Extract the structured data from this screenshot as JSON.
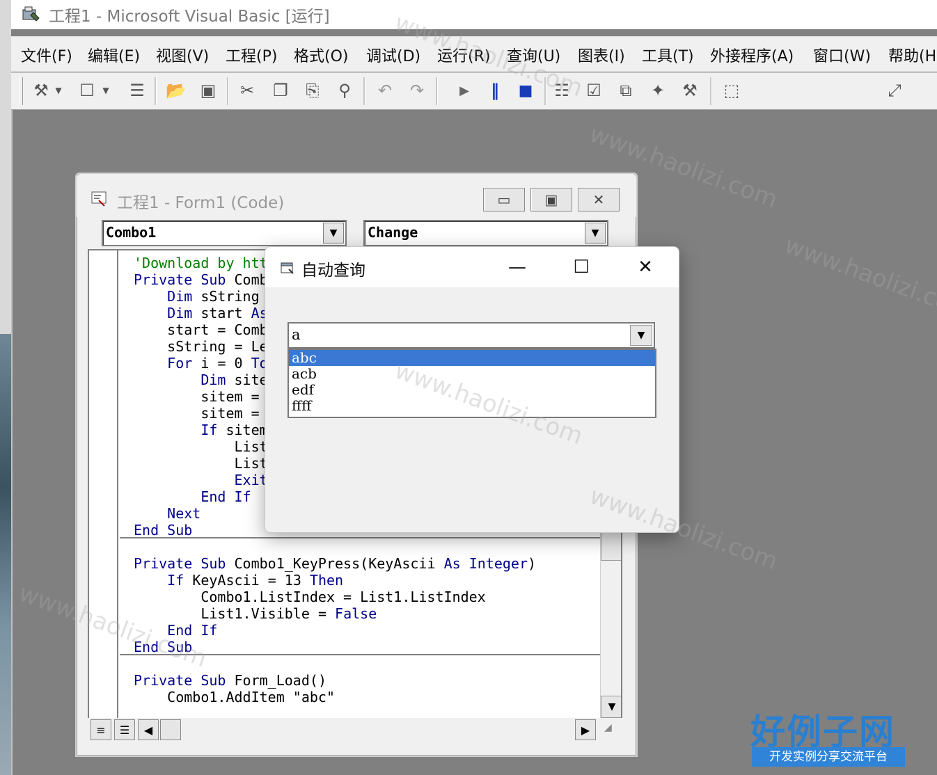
{
  "app": {
    "title": "工程1 - Microsoft Visual Basic [运行]"
  },
  "menu": [
    "文件(F)",
    "编辑(E)",
    "视图(V)",
    "工程(P)",
    "格式(O)",
    "调试(D)",
    "运行(R)",
    "查询(U)",
    "图表(I)",
    "工具(T)",
    "外接程序(A)",
    "窗口(W)",
    "帮助(H"
  ],
  "toolbar": {
    "icons": [
      "add-project-icon",
      "dropdown-arrow-icon",
      "add-form-icon",
      "dropdown-arrow-icon",
      "menu-editor-icon",
      "open-project-icon",
      "save-project-icon",
      "cut-icon",
      "copy-icon",
      "paste-icon",
      "find-icon",
      "undo-icon",
      "redo-icon",
      "start-icon",
      "break-icon",
      "end-icon",
      "project-explorer-icon",
      "properties-window-icon",
      "form-layout-icon",
      "object-browser-icon",
      "toolbox-icon",
      "data-view-icon",
      "position-icon"
    ]
  },
  "code_window": {
    "title": "工程1 - Form1 (Code)",
    "object_combo": "Combo1",
    "proc_combo": "Change",
    "lines": [
      {
        "text": "'Download by htt",
        "color": "comment"
      },
      {
        "text": "Private Sub Comb",
        "color": "mixed"
      },
      {
        "text": "    Dim sString ",
        "color": "mixed"
      },
      {
        "text": "    Dim start As",
        "color": "mixed"
      },
      {
        "text": "    start = Comb",
        "color": "plain"
      },
      {
        "text": "    sString = Le",
        "color": "plain"
      },
      {
        "text": "    For i = 0 To",
        "color": "mixed"
      },
      {
        "text": "        Dim site",
        "color": "mixed"
      },
      {
        "text": "        sitem = ",
        "color": "plain"
      },
      {
        "text": "        sitem = ",
        "color": "plain"
      },
      {
        "text": "        If sitem",
        "color": "mixed"
      },
      {
        "text": "            List",
        "color": "plain"
      },
      {
        "text": "            List",
        "color": "plain"
      },
      {
        "text": "            Exit",
        "color": "keyword"
      },
      {
        "text": "        End If",
        "color": "keyword"
      },
      {
        "text": "    Next",
        "color": "keyword"
      },
      {
        "text": "End Sub",
        "color": "keyword"
      },
      {
        "text": "",
        "color": "plain"
      },
      {
        "text": "Private Sub Combo1_KeyPress(KeyAscii As Integer)",
        "color": "mixed"
      },
      {
        "text": "    If KeyAscii = 13 Then",
        "color": "mixed"
      },
      {
        "text": "        Combo1.ListIndex = List1.ListIndex",
        "color": "plain"
      },
      {
        "text": "        List1.Visible = False",
        "color": "mixed"
      },
      {
        "text": "    End If",
        "color": "keyword"
      },
      {
        "text": "End Sub",
        "color": "keyword"
      },
      {
        "text": "",
        "color": "plain"
      },
      {
        "text": "Private Sub Form_Load()",
        "color": "mixed"
      },
      {
        "text": "    Combo1.AddItem \"abc\"",
        "color": "plain"
      }
    ]
  },
  "dialog": {
    "title": "自动查询",
    "combo_value": "a",
    "list_items": [
      "abc",
      "acb",
      "edf",
      "ffff"
    ],
    "selected_index": 0
  },
  "watermark": {
    "text": "www.haolizi.com",
    "logo": "好例子网",
    "logo_sub": "开发实例分享交流平台"
  },
  "colors": {
    "keyword": "#00008b",
    "comment": "#008000",
    "selection": "#3a78d4"
  }
}
